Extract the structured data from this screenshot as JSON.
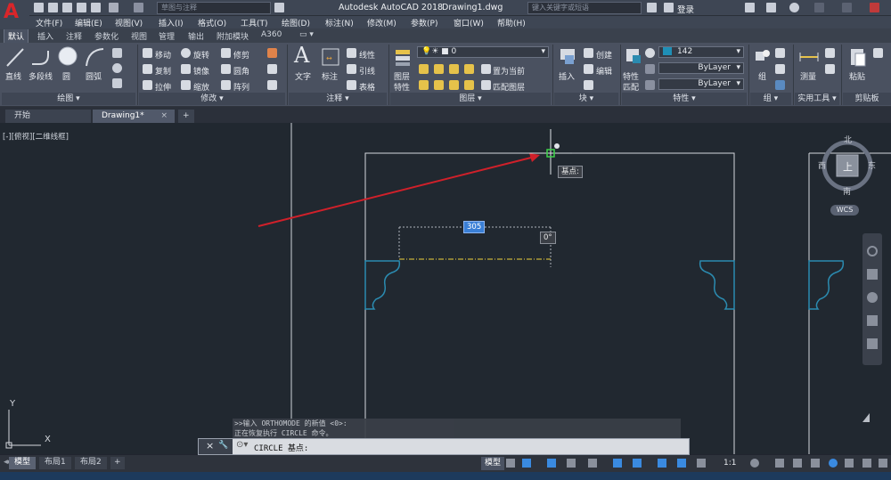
{
  "app": {
    "title": "Autodesk AutoCAD 2018",
    "document": "Drawing1.dwg",
    "workspace_placeholder": "草图与注释",
    "search_placeholder": "键入关键字或短语",
    "login_label": "登录"
  },
  "menu": [
    "文件(F)",
    "编辑(E)",
    "视图(V)",
    "插入(I)",
    "格式(O)",
    "工具(T)",
    "绘图(D)",
    "标注(N)",
    "修改(M)",
    "参数(P)",
    "窗口(W)",
    "帮助(H)"
  ],
  "ribbon_tabs": [
    "默认",
    "插入",
    "注释",
    "参数化",
    "视图",
    "管理",
    "输出",
    "附加模块",
    "A360"
  ],
  "ribbon": {
    "draw": {
      "line": "直线",
      "polyline": "多段线",
      "circle": "圆",
      "arc": "圆弧",
      "panel": "绘图 ▾"
    },
    "modify": {
      "move": "移动",
      "rotate": "旋转",
      "trim": "修剪",
      "copy": "复制",
      "mirror": "镜像",
      "fillet": "圆角",
      "stretch": "拉伸",
      "scale": "缩放",
      "array": "阵列",
      "panel": "修改 ▾"
    },
    "annotation": {
      "text": "文字",
      "dimension": "标注",
      "linear": "线性",
      "leader": "引线",
      "table": "表格",
      "panel": "注释 ▾"
    },
    "layers": {
      "layer_props_1": "图层",
      "layer_props_2": "特性",
      "current_layer": "0",
      "set_current": "置为当前",
      "match_layer": "匹配图层",
      "panel": "图层 ▾"
    },
    "block": {
      "insert": "插入",
      "create": "创建",
      "edit": "编辑",
      "panel": "块 ▾"
    },
    "properties": {
      "match_1": "特性",
      "match_2": "匹配",
      "color": "142",
      "linetype": "ByLayer",
      "lineweight": "ByLayer",
      "panel": "特性 ▾"
    },
    "groups": {
      "group": "组",
      "panel": "组 ▾"
    },
    "utilities": {
      "measure": "测量",
      "panel": "实用工具 ▾"
    },
    "clipboard": {
      "paste": "粘贴",
      "panel": "剪贴板"
    }
  },
  "doc_tabs": [
    "开始",
    "Drawing1*"
  ],
  "viewport_label": "[-][俯视][二维线框]",
  "viewcube": {
    "north": "北",
    "south": "南",
    "east": "东",
    "west": "西",
    "top": "上",
    "wcs": "WCS"
  },
  "tooltips": {
    "base_point": "基点:",
    "length": "305",
    "angle": "0°"
  },
  "ucs": {
    "x": "X",
    "y": "Y"
  },
  "command": {
    "history": [
      ">>输入 ORTHOMODE 的新值 <0>:",
      "正在恢复执行 CIRCLE 命令。"
    ],
    "prompt": "CIRCLE 基点:"
  },
  "layout_tabs": [
    "模型",
    "布局1",
    "布局2"
  ],
  "status": {
    "model": "模型",
    "scale": "1:1"
  },
  "colors": {
    "accent_red": "#d9262a",
    "block_cyan": "#2b8bb0",
    "ribbon_bg": "#4a5160",
    "canvas_bg": "#212830",
    "arrow_red": "#d0202a"
  }
}
